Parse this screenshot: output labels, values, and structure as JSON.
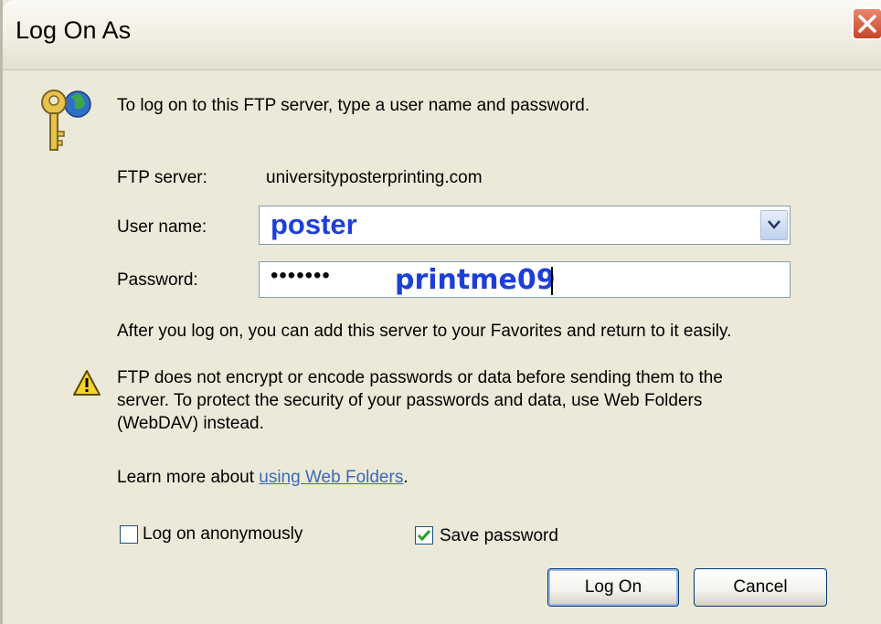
{
  "window": {
    "title": "Log On As"
  },
  "intro_text": "To log on to this FTP server, type a user name and password.",
  "ftp_server": {
    "label": "FTP server:",
    "value": "universityposterprinting.com"
  },
  "user_name": {
    "label": "User name:",
    "value": "poster"
  },
  "password": {
    "label": "Password:",
    "masked_value": "•••••••",
    "annotation": "printme09"
  },
  "favorites_text": "After you log on, you can add this server to your Favorites and return to it easily.",
  "warning": {
    "line1": "FTP does not encrypt or encode passwords or data before sending them to the",
    "line2": "server.  To protect the security of your passwords and data, use Web Folders",
    "line3": "(WebDAV) instead."
  },
  "learn_more": {
    "prefix": "Learn more about ",
    "link": "using Web Folders",
    "suffix": "."
  },
  "options": {
    "anonymous_label": "Log on anonymously",
    "anonymous_checked": false,
    "save_password_label": "Save password",
    "save_password_checked": true
  },
  "buttons": {
    "log_on": "Log On",
    "cancel": "Cancel"
  },
  "colors": {
    "dialog_bg": "#ece9d8",
    "annotation_blue": "#1d3fd9",
    "link": "#3a6ab7",
    "close_red": "#c6452c"
  },
  "icons": [
    "keys-globe-icon",
    "warning-icon",
    "close-icon",
    "chevron-down-icon",
    "checkmark-icon"
  ]
}
